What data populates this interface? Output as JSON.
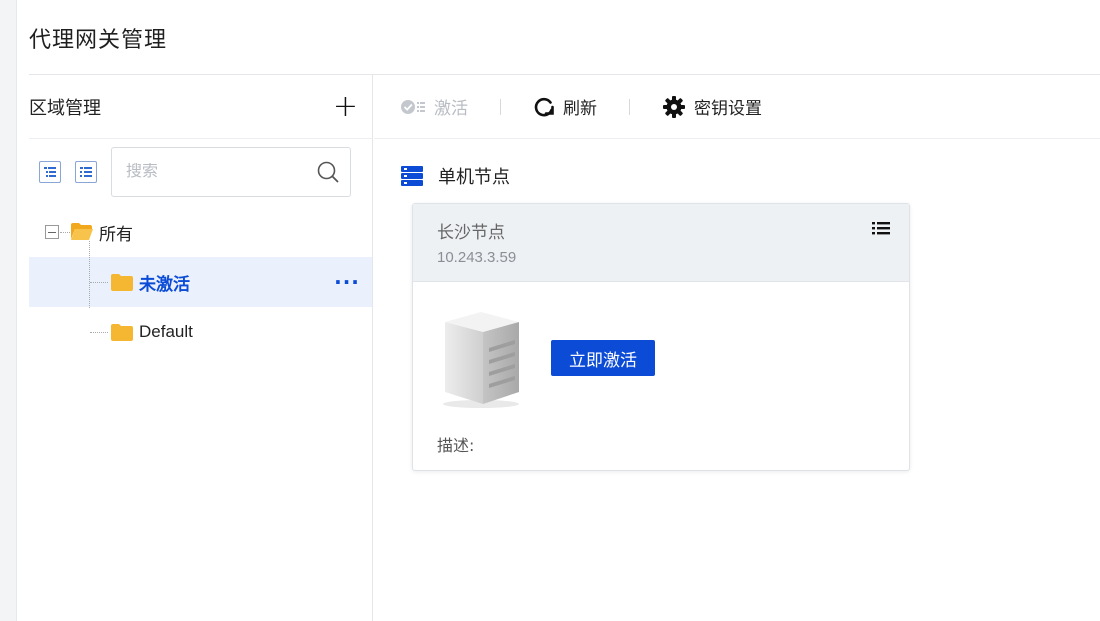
{
  "page": {
    "title": "代理网关管理"
  },
  "sidebar": {
    "title": "区域管理",
    "add_label": "+",
    "search": {
      "placeholder": "搜索",
      "value": ""
    },
    "tree": {
      "root": "所有",
      "children": [
        {
          "label": "未激活",
          "selected": true,
          "more": "···"
        },
        {
          "label": "Default",
          "selected": false
        }
      ]
    }
  },
  "toolbar": {
    "activate_label": "激活",
    "refresh_label": "刷新",
    "key_settings_label": "密钥设置"
  },
  "main": {
    "section_title": "单机节点",
    "card": {
      "title": "长沙节点",
      "ip": "10.243.3.59",
      "activate_button": "立即激活",
      "description_label": "描述:"
    }
  },
  "colors": {
    "accent": "#0b4bd6",
    "folder": "#f5b731",
    "selected_bg": "#eaf1fd",
    "card_head_bg": "#eef1f4"
  }
}
